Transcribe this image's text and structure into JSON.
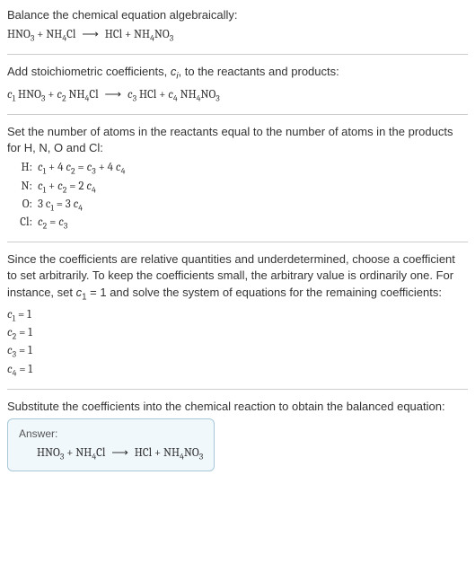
{
  "sec1": {
    "title": "Balance the chemical equation algebraically:",
    "eq_lhs1": "HNO",
    "eq_lhs1_sub": "3",
    "plus1": " + NH",
    "eq_lhs2_sub": "4",
    "eq_lhs2_end": "Cl ",
    "arrow": "⟶",
    "eq_rhs1": " HCl + NH",
    "eq_rhs2_sub": "4",
    "eq_rhs2_mid": "NO",
    "eq_rhs3_sub": "3"
  },
  "sec2": {
    "title_a": "Add stoichiometric coefficients, ",
    "title_ci": "c",
    "title_i": "i",
    "title_b": ", to the reactants and products:",
    "c1": "c",
    "s1": "1",
    "sp1": " HNO",
    "sub1": "3",
    "plus": " + ",
    "c2": "c",
    "s2": "2",
    "sp2": " NH",
    "sub2": "4",
    "sp2b": "Cl ",
    "arrow": "⟶",
    "c3": "c",
    "s3": "3",
    "sp3": " HCl + ",
    "c4": "c",
    "s4": "4",
    "sp4": " NH",
    "sub4": "4",
    "sp4b": "NO",
    "sub4b": "3"
  },
  "sec3": {
    "title": "Set the number of atoms in the reactants equal to the number of atoms in the products for H, N, O and Cl:",
    "rows": [
      {
        "label": "H:",
        "c1": "c",
        "s1": "1",
        "t1": " + 4 ",
        "c2": "c",
        "s2": "2",
        "eq": " = ",
        "c3": "c",
        "s3": "3",
        "t2": " + 4 ",
        "c4": "c",
        "s4": "4"
      },
      {
        "label": "N:",
        "c1": "c",
        "s1": "1",
        "t1": " + ",
        "c2": "c",
        "s2": "2",
        "eq": " = 2 ",
        "c3": "c",
        "s3": "4",
        "t2": "",
        "c4": "",
        "s4": ""
      },
      {
        "label": "O:",
        "c1": "3 c",
        "s1": "1",
        "t1": "",
        "c2": "",
        "s2": "",
        "eq": " = 3 ",
        "c3": "c",
        "s3": "4",
        "t2": "",
        "c4": "",
        "s4": ""
      },
      {
        "label": "Cl:",
        "c1": "c",
        "s1": "2",
        "t1": "",
        "c2": "",
        "s2": "",
        "eq": " = ",
        "c3": "c",
        "s3": "3",
        "t2": "",
        "c4": "",
        "s4": ""
      }
    ]
  },
  "sec4": {
    "text_a": "Since the coefficients are relative quantities and underdetermined, choose a coefficient to set arbitrarily. To keep the coefficients small, the arbitrary value is ordinarily one. For instance, set ",
    "c1": "c",
    "s1": "1",
    "text_b": " = 1 and solve the system of equations for the remaining coefficients:",
    "coefs": [
      {
        "c": "c",
        "s": "1",
        "v": " = 1"
      },
      {
        "c": "c",
        "s": "2",
        "v": " = 1"
      },
      {
        "c": "c",
        "s": "3",
        "v": " = 1"
      },
      {
        "c": "c",
        "s": "4",
        "v": " = 1"
      }
    ]
  },
  "sec5": {
    "title": "Substitute the coefficients into the chemical reaction to obtain the balanced equation:",
    "answer_label": "Answer:",
    "eq_lhs1": "HNO",
    "eq_lhs1_sub": "3",
    "plus1": " + NH",
    "eq_lhs2_sub": "4",
    "eq_lhs2_end": "Cl ",
    "arrow": "⟶",
    "eq_rhs1": " HCl + NH",
    "eq_rhs2_sub": "4",
    "eq_rhs2_mid": "NO",
    "eq_rhs3_sub": "3"
  }
}
